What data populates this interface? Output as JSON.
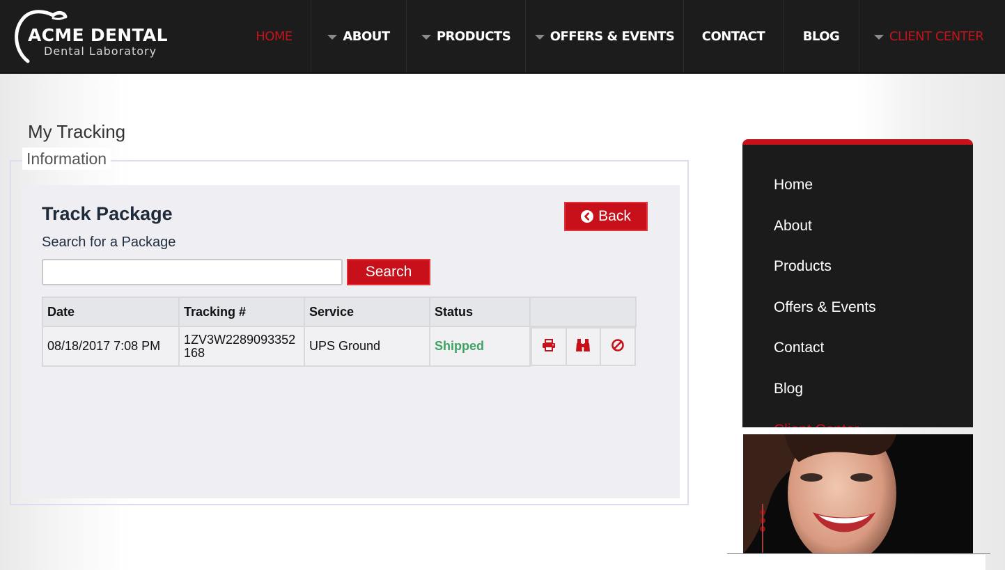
{
  "brand": {
    "name": "ACME DENTAL",
    "subtitle": "Dental  Laboratory"
  },
  "nav": {
    "items": [
      {
        "label": "HOME",
        "dropdown": false,
        "active": true
      },
      {
        "label": "ABOUT",
        "dropdown": true,
        "active": false
      },
      {
        "label": "PRODUCTS",
        "dropdown": true,
        "active": false
      },
      {
        "label": "OFFERS & EVENTS",
        "dropdown": true,
        "active": false
      },
      {
        "label": "CONTACT",
        "dropdown": false,
        "active": false
      },
      {
        "label": "BLOG",
        "dropdown": false,
        "active": false
      },
      {
        "label": "CLIENT CENTER",
        "dropdown": true,
        "active": true
      }
    ]
  },
  "page": {
    "cropped_heading": "My Tracking",
    "legend": "Information",
    "title": "Track Package",
    "search_label": "Search for a Package",
    "search_value": "",
    "search_button": "Search",
    "back_button": "Back"
  },
  "table": {
    "columns": [
      "Date",
      "Tracking #",
      "Service",
      "Status",
      ""
    ],
    "rows": [
      {
        "date": "08/18/2017 7:08 PM",
        "tracking_line1": "1ZV3W2289093352",
        "tracking_line2": "168",
        "service": "UPS Ground",
        "status": "Shipped",
        "actions": [
          "print-icon",
          "binoculars-icon",
          "ban-icon"
        ]
      }
    ]
  },
  "sidebar": {
    "items": [
      "Home",
      "About",
      "Products",
      "Offers & Events",
      "Contact",
      "Blog",
      "Client Center"
    ]
  },
  "colors": {
    "accent_red": "#c8101a",
    "nav_bg": "#1c1c1c",
    "status_green": "#3fa263",
    "panel_bg": "#eeeef3"
  }
}
